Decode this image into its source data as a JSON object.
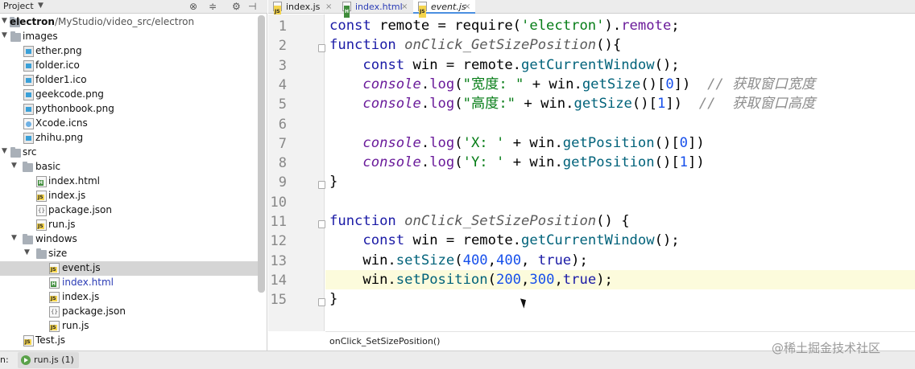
{
  "project_panel": {
    "title": "Project",
    "icons": [
      "settings-sync-icon",
      "collapse-icon",
      "gear-icon",
      "hide-icon"
    ],
    "tree": [
      {
        "label": "electron",
        "suffix": "/MyStudio/video_src/electron",
        "type": "folder",
        "expanded": true
      },
      {
        "label": "images",
        "type": "folder",
        "expanded": true
      },
      {
        "label": "ether.png",
        "type": "image"
      },
      {
        "label": "folder.ico",
        "type": "image"
      },
      {
        "label": "folder1.ico",
        "type": "image"
      },
      {
        "label": "geekcode.png",
        "type": "image"
      },
      {
        "label": "pythonbook.png",
        "type": "image"
      },
      {
        "label": "Xcode.icns",
        "type": "icns"
      },
      {
        "label": "zhihu.png",
        "type": "image"
      },
      {
        "label": "src",
        "type": "folder",
        "expanded": true
      },
      {
        "label": "basic",
        "type": "folder",
        "expanded": true
      },
      {
        "label": "index.html",
        "type": "html"
      },
      {
        "label": "index.js",
        "type": "js"
      },
      {
        "label": "package.json",
        "type": "json"
      },
      {
        "label": "run.js",
        "type": "js"
      },
      {
        "label": "windows",
        "type": "folder",
        "expanded": true
      },
      {
        "label": "size",
        "type": "folder",
        "expanded": true
      },
      {
        "label": "event.js",
        "type": "js",
        "selected": true
      },
      {
        "label": "index.html",
        "type": "html",
        "link": true
      },
      {
        "label": "index.js",
        "type": "js"
      },
      {
        "label": "package.json",
        "type": "json"
      },
      {
        "label": "run.js",
        "type": "js"
      },
      {
        "label": "Test.js",
        "type": "js"
      }
    ]
  },
  "editor": {
    "tabs": [
      {
        "label": "index.js",
        "type": "js"
      },
      {
        "label": "index.html",
        "type": "html"
      },
      {
        "label": "event.js",
        "type": "js",
        "active": true
      }
    ],
    "close_glyph": "×",
    "line_numbers": [
      "1",
      "2",
      "3",
      "4",
      "5",
      "6",
      "7",
      "8",
      "9",
      "10",
      "11",
      "12",
      "13",
      "14",
      "15"
    ],
    "current_line": 14,
    "lines": [
      "const remote = require('electron').remote;",
      "function onClick_GetSizePosition(){",
      "    const win = remote.getCurrentWindow();",
      "    console.log(\"宽度: \" + win.getSize()[0])  // 获取窗口宽度",
      "    console.log(\"高度:\" + win.getSize()[1])  //  获取窗口高度",
      "",
      "    console.log('X: ' + win.getPosition()[0])",
      "    console.log('Y: ' + win.getPosition()[1])",
      "}",
      "",
      "function onClick_SetSizePosition() {",
      "    const win = remote.getCurrentWindow();",
      "    win.setSize(400,400, true);",
      "    win.setPosition(200,300,true);",
      "}"
    ],
    "breadcrumb": "onClick_SetSizePosition()"
  },
  "run_bar": {
    "prefix": "n:",
    "tab_label": "run.js (1)"
  },
  "watermark": "@稀土掘金技术社区",
  "colors": {
    "keyword": "#1a1aa6",
    "string": "#067d17",
    "number": "#1750eb",
    "comment": "#8c8c8c",
    "current_line": "#fcfbdc",
    "active_tab_underline": "#4a8fe0"
  }
}
